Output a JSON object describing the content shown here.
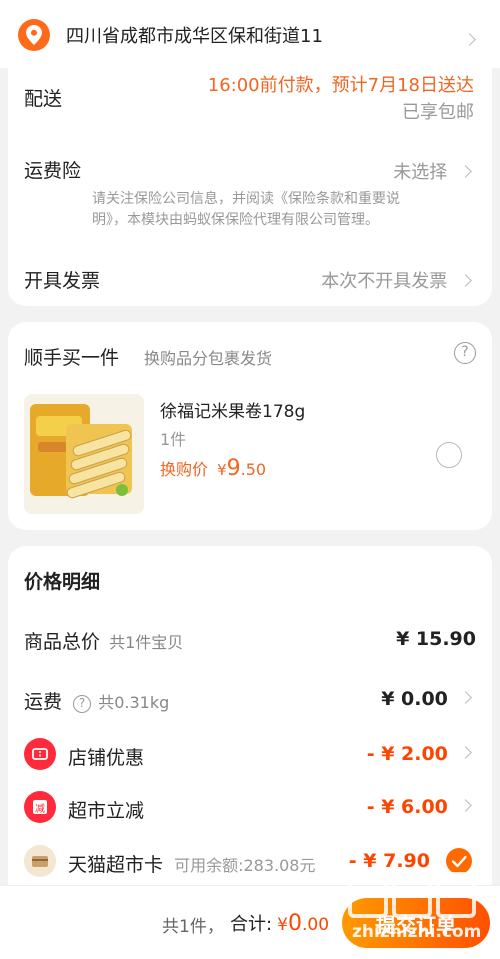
{
  "address": {
    "text": "四川省成都市成华区保和街道11"
  },
  "delivery": {
    "label": "配送",
    "time": "16:00前付款，预计7月18日送达",
    "free": "已享包邮"
  },
  "insurance": {
    "label": "运费险",
    "value": "未选择",
    "note_line1": "请关注保险公司信息，并阅读《保险条款和重要说",
    "note_line2": "明》，本模块由蚂蚁保保险代理有限公司管理。"
  },
  "invoice": {
    "label": "开具发票",
    "value": "本次不开具发票"
  },
  "addon": {
    "title": "顺手买一件",
    "subtitle": "换购品分包裹发货",
    "product_name": "徐福记米果卷178g",
    "quantity": "1件",
    "price_label": "换购价",
    "currency": "¥",
    "price_int": "9",
    "price_dec": ".50"
  },
  "price_detail": {
    "title": "价格明细",
    "rows": [
      {
        "label": "商品总价",
        "sub": "共1件宝贝",
        "value": "¥ 15.90"
      },
      {
        "label": "运费",
        "sub": "共0.31kg",
        "value": "¥ 0.00"
      },
      {
        "label": "店铺优惠",
        "sub": "",
        "value": "- ¥ 2.00"
      },
      {
        "label": "超市立减",
        "sub": "",
        "value": "- ¥ 6.00"
      },
      {
        "label": "天猫超市卡",
        "sub": "可用余额:283.08元",
        "value": "- ¥ 7.90"
      }
    ]
  },
  "bottom": {
    "count": "共1件，",
    "total_label": "合计:",
    "currency": "¥",
    "total_int": "0",
    "total_dec": ".00",
    "submit": "提交订单"
  },
  "watermark": {
    "site": "zhizhizhi.com"
  },
  "colors": {
    "accent": "#ff5000",
    "orange_text": "#f26522"
  }
}
